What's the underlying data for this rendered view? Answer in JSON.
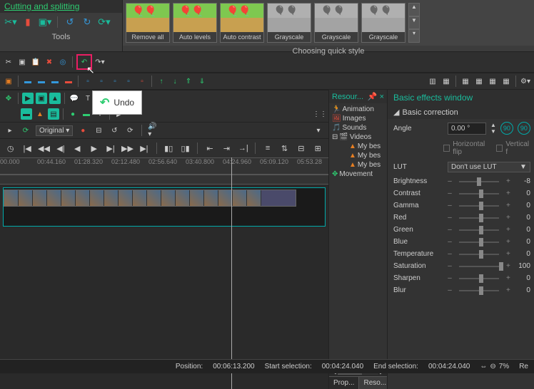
{
  "cutting_panel": {
    "title": "Cutting and splitting",
    "tools_label": "Tools"
  },
  "styles_panel": {
    "items": [
      {
        "label": "Remove all",
        "gray": false
      },
      {
        "label": "Auto levels",
        "gray": false
      },
      {
        "label": "Auto contrast",
        "gray": false
      },
      {
        "label": "Grayscale",
        "gray": true
      },
      {
        "label": "Grayscale",
        "gray": true
      },
      {
        "label": "Grayscale",
        "gray": true
      }
    ],
    "caption": "Choosing quick style"
  },
  "tooltip": {
    "text": "Undo"
  },
  "preview": {
    "mode": "Original"
  },
  "timeline": {
    "labels": [
      "00.000",
      "00:44.160",
      "01:28.320",
      "02:12.480",
      "02:56.640",
      "03:40.800",
      "04:24.960",
      "05:09.120",
      "05:53.28"
    ]
  },
  "resources": {
    "title": "Resour...",
    "tree": {
      "animation": "Animation",
      "images": "Images",
      "sounds": "Sounds",
      "videos": "Videos",
      "clips": [
        "My bes",
        "My bes",
        "My bes"
      ],
      "movement": "Movement"
    },
    "tabs": [
      "Prop...",
      "Reso..."
    ]
  },
  "effects": {
    "title": "Basic effects window",
    "section": "Basic correction",
    "angle_label": "Angle",
    "angle_value": "0.00 °",
    "hflip": "Horizontal flip",
    "vflip": "Vertical f",
    "lut_label": "LUT",
    "lut_value": "Don't use LUT",
    "sliders": [
      {
        "name": "Brightness",
        "val": "-8",
        "pos": 45
      },
      {
        "name": "Contrast",
        "val": "0",
        "pos": 50
      },
      {
        "name": "Gamma",
        "val": "0",
        "pos": 50
      },
      {
        "name": "Red",
        "val": "0",
        "pos": 50
      },
      {
        "name": "Green",
        "val": "0",
        "pos": 50
      },
      {
        "name": "Blue",
        "val": "0",
        "pos": 50
      },
      {
        "name": "Temperature",
        "val": "0",
        "pos": 50
      },
      {
        "name": "Saturation",
        "val": "100",
        "pos": 100
      },
      {
        "name": "Sharpen",
        "val": "0",
        "pos": 50
      },
      {
        "name": "Blur",
        "val": "0",
        "pos": 50
      }
    ]
  },
  "status": {
    "position_label": "Position:",
    "position_val": "00:06:13.200",
    "start_label": "Start selection:",
    "start_val": "00:04:24.040",
    "end_label": "End selection:",
    "end_val": "00:04:24.040",
    "zoom": "7%",
    "extra": "Re"
  }
}
